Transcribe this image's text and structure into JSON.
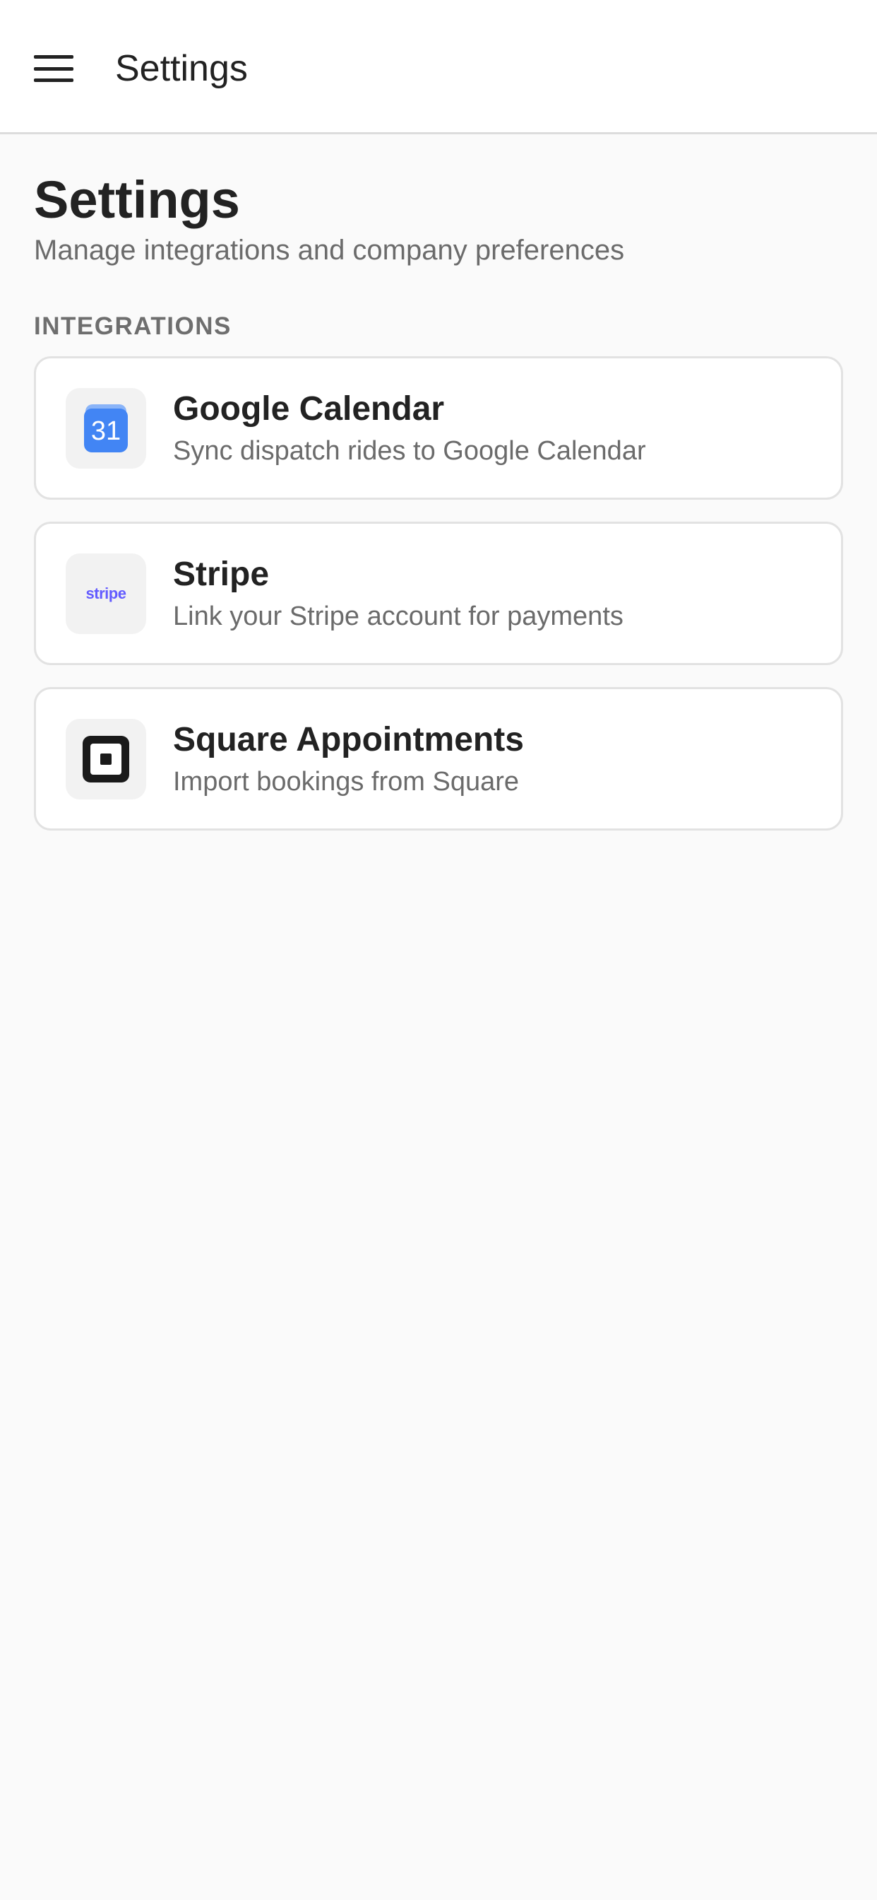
{
  "app_bar": {
    "title": "Settings",
    "menu_icon": "hamburger-menu-icon"
  },
  "page": {
    "title": "Settings",
    "subtitle": "Manage integrations and company preferences"
  },
  "section": {
    "label": "INTEGRATIONS"
  },
  "integrations": [
    {
      "title": "Google Calendar",
      "description": "Sync dispatch rides to Google Calendar",
      "icon": "google-calendar-icon",
      "icon_text": "31"
    },
    {
      "title": "Stripe",
      "description": "Link your Stripe account for payments",
      "icon": "stripe-logo-icon",
      "icon_text": "stripe"
    },
    {
      "title": "Square Appointments",
      "description": "Import bookings from Square",
      "icon": "square-logo-icon"
    }
  ],
  "colors": {
    "background": "#fafafa",
    "surface": "#ffffff",
    "text_primary": "#222222",
    "text_secondary": "#6b6b6b",
    "border": "#e2e2e2",
    "google_blue": "#4285f4",
    "stripe_purple": "#635bff",
    "square_black": "#1a1a1a"
  }
}
